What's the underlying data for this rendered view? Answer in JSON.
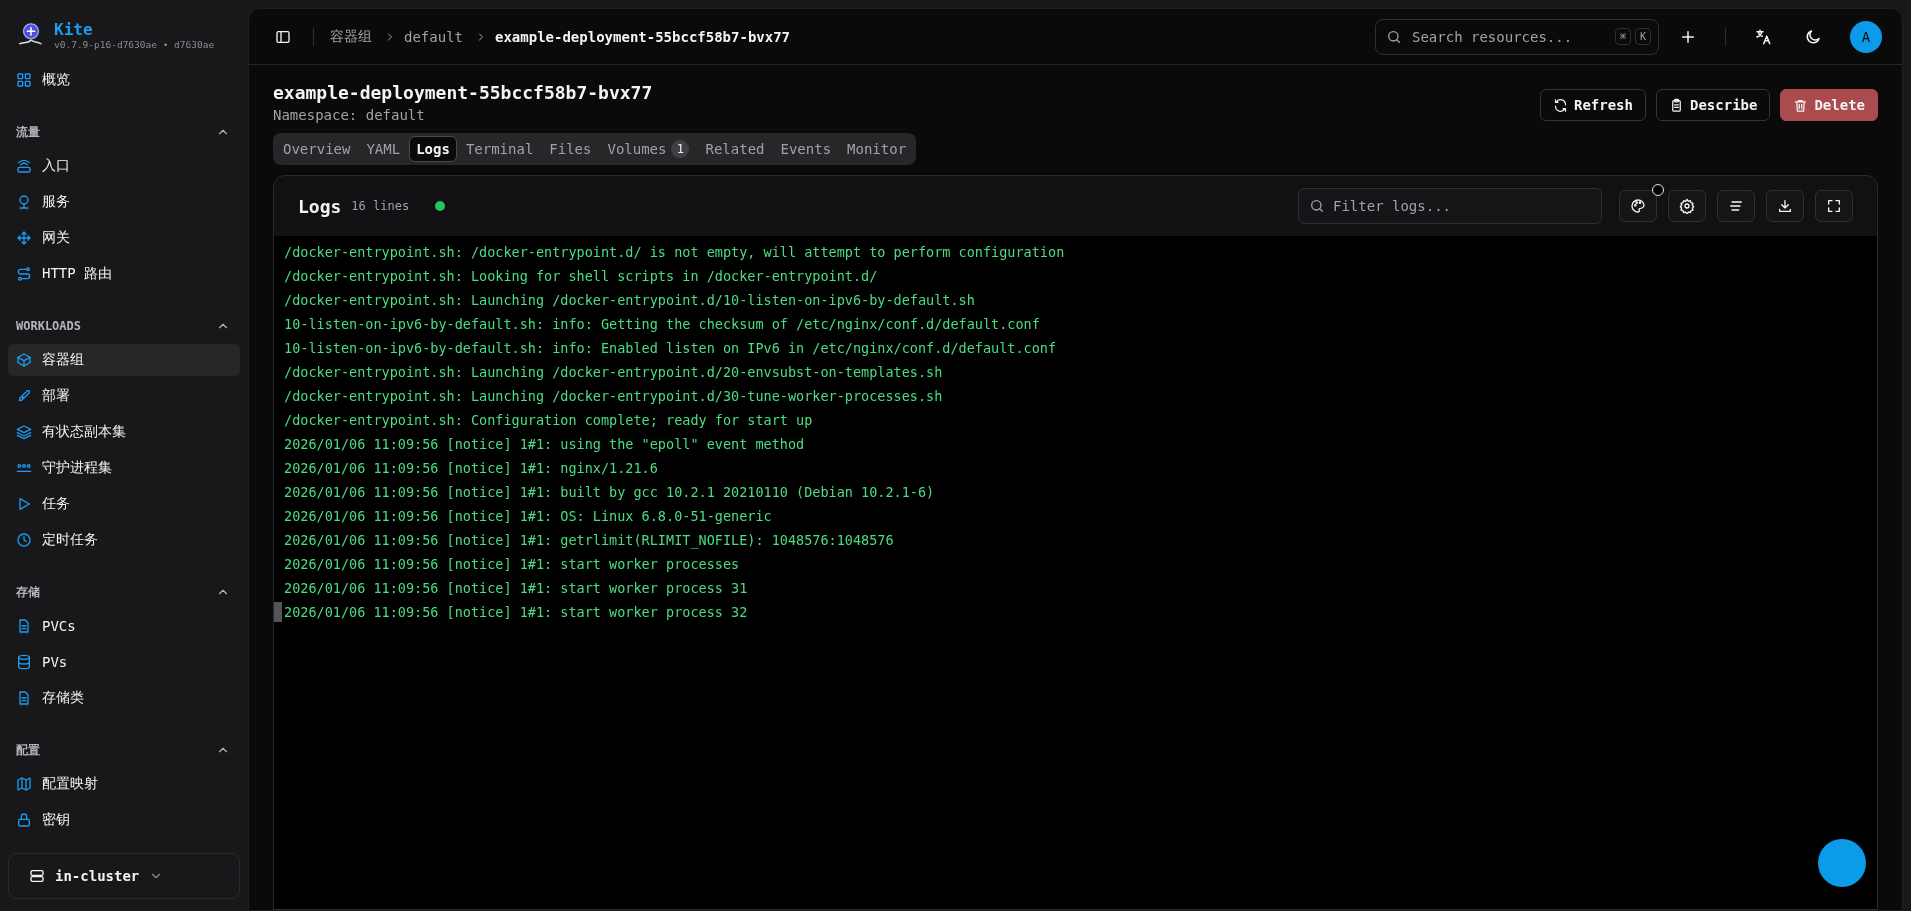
{
  "sidebar": {
    "brand": {
      "name": "Kite",
      "version": "v0.7.9-p16-d7630ae • d7630ae"
    },
    "sections": [
      {
        "items": [
          {
            "label": "概览",
            "selected": false
          }
        ]
      },
      {
        "title": "流量",
        "expanded": true,
        "items": [
          {
            "label": "入口",
            "selected": false
          },
          {
            "label": "服务",
            "selected": false
          },
          {
            "label": "网关",
            "selected": false
          },
          {
            "label": "HTTP 路由",
            "selected": false
          }
        ]
      },
      {
        "title": "WORKLOADS",
        "expanded": true,
        "items": [
          {
            "label": "容器组",
            "selected": true
          },
          {
            "label": "部署",
            "selected": false
          },
          {
            "label": "有状态副本集",
            "selected": false
          },
          {
            "label": "守护进程集",
            "selected": false
          },
          {
            "label": "任务",
            "selected": false
          },
          {
            "label": "定时任务",
            "selected": false
          }
        ]
      },
      {
        "title": "存储",
        "expanded": true,
        "items": [
          {
            "label": "PVCs",
            "selected": false
          },
          {
            "label": "PVs",
            "selected": false
          },
          {
            "label": "存储类",
            "selected": false
          }
        ]
      },
      {
        "title": "配置",
        "expanded": true,
        "items": [
          {
            "label": "配置映射",
            "selected": false
          },
          {
            "label": "密钥",
            "selected": false
          }
        ]
      }
    ],
    "cluster": "in-cluster"
  },
  "header": {
    "breadcrumbs": [
      "容器组",
      "default",
      "example-deployment-55bccf58b7-bvx77"
    ],
    "search": {
      "placeholder": "Search resources...",
      "keys": [
        "⌘",
        "K"
      ]
    },
    "avatar": "A"
  },
  "page": {
    "title": "example-deployment-55bccf58b7-bvx77",
    "namespace": "Namespace: default",
    "buttons": [
      {
        "label": "Refresh",
        "kind": "default"
      },
      {
        "label": "Describe",
        "kind": "default"
      },
      {
        "label": "Delete",
        "kind": "danger"
      }
    ],
    "tabs": [
      {
        "label": "Overview",
        "selected": false
      },
      {
        "label": "YAML",
        "selected": false
      },
      {
        "label": "Logs",
        "selected": true
      },
      {
        "label": "Terminal",
        "selected": false
      },
      {
        "label": "Files",
        "selected": false
      },
      {
        "label": "Volumes",
        "selected": false,
        "badge": "1"
      },
      {
        "label": "Related",
        "selected": false
      },
      {
        "label": "Events",
        "selected": false
      },
      {
        "label": "Monitor",
        "selected": false
      }
    ]
  },
  "logs": {
    "title": "Logs",
    "count": "16 lines",
    "connected": true,
    "filter": {
      "placeholder": "Filter logs..."
    },
    "cursor": true,
    "lines": [
      "/docker-entrypoint.sh: /docker-entrypoint.d/ is not empty, will attempt to perform configuration",
      "/docker-entrypoint.sh: Looking for shell scripts in /docker-entrypoint.d/",
      "/docker-entrypoint.sh: Launching /docker-entrypoint.d/10-listen-on-ipv6-by-default.sh",
      "10-listen-on-ipv6-by-default.sh: info: Getting the checksum of /etc/nginx/conf.d/default.conf",
      "10-listen-on-ipv6-by-default.sh: info: Enabled listen on IPv6 in /etc/nginx/conf.d/default.conf",
      "/docker-entrypoint.sh: Launching /docker-entrypoint.d/20-envsubst-on-templates.sh",
      "/docker-entrypoint.sh: Launching /docker-entrypoint.d/30-tune-worker-processes.sh",
      "/docker-entrypoint.sh: Configuration complete; ready for start up",
      "2026/01/06 11:09:56 [notice] 1#1: using the \"epoll\" event method",
      "2026/01/06 11:09:56 [notice] 1#1: nginx/1.21.6",
      "2026/01/06 11:09:56 [notice] 1#1: built by gcc 10.2.1 20210110 (Debian 10.2.1-6)",
      "2026/01/06 11:09:56 [notice] 1#1: OS: Linux 6.8.0-51-generic",
      "2026/01/06 11:09:56 [notice] 1#1: getrlimit(RLIMIT_NOFILE): 1048576:1048576",
      "2026/01/06 11:09:56 [notice] 1#1: start worker processes",
      "2026/01/06 11:09:56 [notice] 1#1: start worker process 31",
      "2026/01/06 11:09:56 [notice] 1#1: start worker process 32"
    ]
  }
}
